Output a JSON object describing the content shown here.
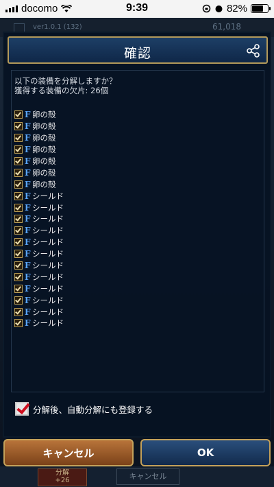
{
  "status_bar": {
    "carrier": "docomo",
    "time": "9:39",
    "battery": "82%",
    "battery_level": 0.82
  },
  "background": {
    "version": "ver1.0.1 (132)",
    "money": "61,018",
    "bottom_button_line1": "分解",
    "bottom_button_line2": "+26",
    "bottom_cancel": "キャンセル"
  },
  "dialog": {
    "title": "確認",
    "question_line1": "以下の装備を分解しますか？",
    "question_line2": "獲得する装備の欠片: 26個",
    "items": [
      {
        "rank": "F",
        "name": "卵の殻"
      },
      {
        "rank": "F",
        "name": "卵の殻"
      },
      {
        "rank": "F",
        "name": "卵の殻"
      },
      {
        "rank": "F",
        "name": "卵の殻"
      },
      {
        "rank": "F",
        "name": "卵の殻"
      },
      {
        "rank": "F",
        "name": "卵の殻"
      },
      {
        "rank": "F",
        "name": "卵の殻"
      },
      {
        "rank": "F",
        "name": "シールド"
      },
      {
        "rank": "F",
        "name": "シールド"
      },
      {
        "rank": "F",
        "name": "シールド"
      },
      {
        "rank": "F",
        "name": "シールド"
      },
      {
        "rank": "F",
        "name": "シールド"
      },
      {
        "rank": "F",
        "name": "シールド"
      },
      {
        "rank": "F",
        "name": "シールド"
      },
      {
        "rank": "F",
        "name": "シールド"
      },
      {
        "rank": "F",
        "name": "シールド"
      },
      {
        "rank": "F",
        "name": "シールド"
      },
      {
        "rank": "F",
        "name": "シールド"
      },
      {
        "rank": "F",
        "name": "シールド"
      }
    ],
    "auto_register_label": "分解後、自動分解にも登録する",
    "cancel_label": "キャンセル",
    "ok_label": "OK"
  },
  "colors": {
    "accent_gold": "#b49a5a",
    "rank_blue": "#5aa6ff",
    "checkmark_red": "#d01020"
  },
  "icons": {
    "share": "share-icon",
    "wifi": "wifi-icon",
    "battery": "battery-icon"
  }
}
